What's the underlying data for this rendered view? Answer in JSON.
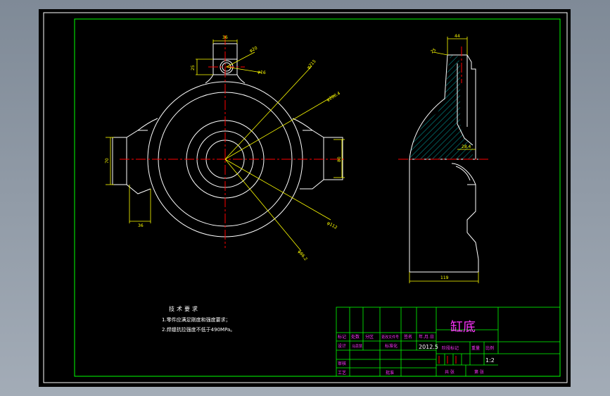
{
  "drawing": {
    "title": "缸底",
    "scale": "1:2",
    "date": "2012.5",
    "notes_heading": "技术要求",
    "notes": [
      "1.零件应满足刚度和强度要求；",
      "2.焊缝抗拉强度不低于490MPa。"
    ],
    "dimensions": {
      "top_width": "36",
      "boss_height": "25",
      "hole_dia": "φ20",
      "hole_dia2": "φ16",
      "dia_large": "φ215",
      "dia_pcd": "φ200.4",
      "left_height": "70",
      "right_height": "80",
      "left_offset": "36",
      "dia_small": "φ112",
      "dia_hub": "φ86.2",
      "side_top": "44",
      "side_chamfer": "25",
      "side_depth": "28.4",
      "side_total": "119"
    },
    "title_block": {
      "row1": [
        "标记",
        "处数",
        "分区",
        "更改文件号",
        "签名",
        "年.月.日"
      ],
      "design_label": "设计",
      "designer": "马思慧",
      "std_label": "标准化",
      "stage_label": "阶段标记",
      "weight_label": "重量",
      "scale_label": "比例",
      "check_label": "审核",
      "craft_label": "工艺",
      "approve_label": "批准",
      "sheets_label": "共  张",
      "sheet_label": "第  张"
    }
  },
  "colors": {
    "background": "#000000",
    "border": "#00ff00",
    "outline": "#ffffff",
    "center": "#ff0000",
    "dimension": "#ffff00",
    "hatch": "#00c8c8",
    "title": "#ff33ff"
  }
}
